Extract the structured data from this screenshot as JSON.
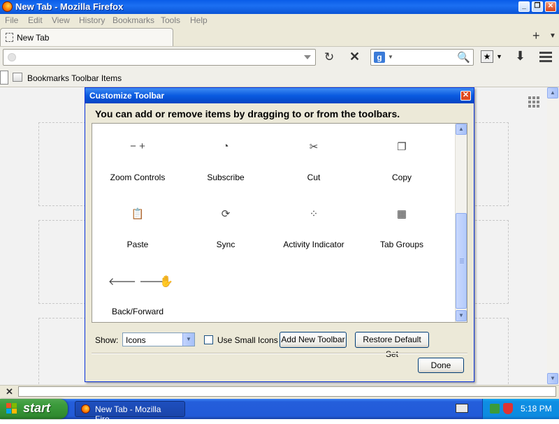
{
  "window": {
    "title": "New Tab - Mozilla Firefox",
    "controls": {
      "minimize": "_",
      "restore": "❐",
      "close": "✕"
    }
  },
  "menubar": {
    "items": [
      {
        "label": "File",
        "accesskey": "F"
      },
      {
        "label": "Edit",
        "accesskey": "E"
      },
      {
        "label": "View",
        "accesskey": "V"
      },
      {
        "label": "History",
        "accesskey": "s"
      },
      {
        "label": "Bookmarks",
        "accesskey": "B"
      },
      {
        "label": "Tools",
        "accesskey": "T"
      },
      {
        "label": "Help",
        "accesskey": "H"
      }
    ]
  },
  "tabs": {
    "items": [
      {
        "label": "New Tab"
      }
    ],
    "new_tab_glyph": "+",
    "list_glyph": "▼"
  },
  "navbar": {
    "url_value": "",
    "url_placeholder": "",
    "search_engine_letter": "g",
    "search_placeholder": "",
    "reload_glyph": "↻",
    "stop_glyph": "✕",
    "download_glyph": "⬇",
    "search_glyph": "🔍",
    "bookmark_star_glyph": "★"
  },
  "bookmarks_toolbar": {
    "label": "Bookmarks Toolbar Items"
  },
  "dialog": {
    "title": "Customize Toolbar",
    "close_glyph": "✕",
    "instructions": "You can add or remove items by dragging to or from the toolbars.",
    "items": [
      {
        "label": "Zoom Controls",
        "icon": "zoom-controls-icon",
        "glyph": "−  +"
      },
      {
        "label": "Subscribe",
        "icon": "rss-feed-icon",
        "glyph": "◔"
      },
      {
        "label": "Cut",
        "icon": "scissors-icon",
        "glyph": "✂"
      },
      {
        "label": "Copy",
        "icon": "copy-icon",
        "glyph": "❐"
      },
      {
        "label": "Paste",
        "icon": "clipboard-icon",
        "glyph": "📋"
      },
      {
        "label": "Sync",
        "icon": "sync-icon",
        "glyph": "⟳"
      },
      {
        "label": "Activity Indicator",
        "icon": "spinner-icon",
        "glyph": "⁘"
      },
      {
        "label": "Tab Groups",
        "icon": "tab-groups-icon",
        "glyph": "▦"
      },
      {
        "label": "Back/Forward",
        "icon": "back-forward-icon",
        "glyph": "🡐 🡒"
      }
    ],
    "show_label": "Show:",
    "show_value": "Icons",
    "small_icons_label": "Use Small Icons",
    "small_icons_checked": false,
    "add_toolbar_label": "Add New Toolbar",
    "restore_label": "Restore Default Set",
    "done_label": "Done"
  },
  "statusbar": {
    "close_glyph": "✕",
    "value": ""
  },
  "taskbar": {
    "start_label": "start",
    "window_item": "New Tab - Mozilla Fire...",
    "clock": "5:18 PM"
  },
  "colors": {
    "xp_blue": "#0a5de8",
    "start_green": "#3c9b3c",
    "dialog_bg": "#ece9d8"
  }
}
